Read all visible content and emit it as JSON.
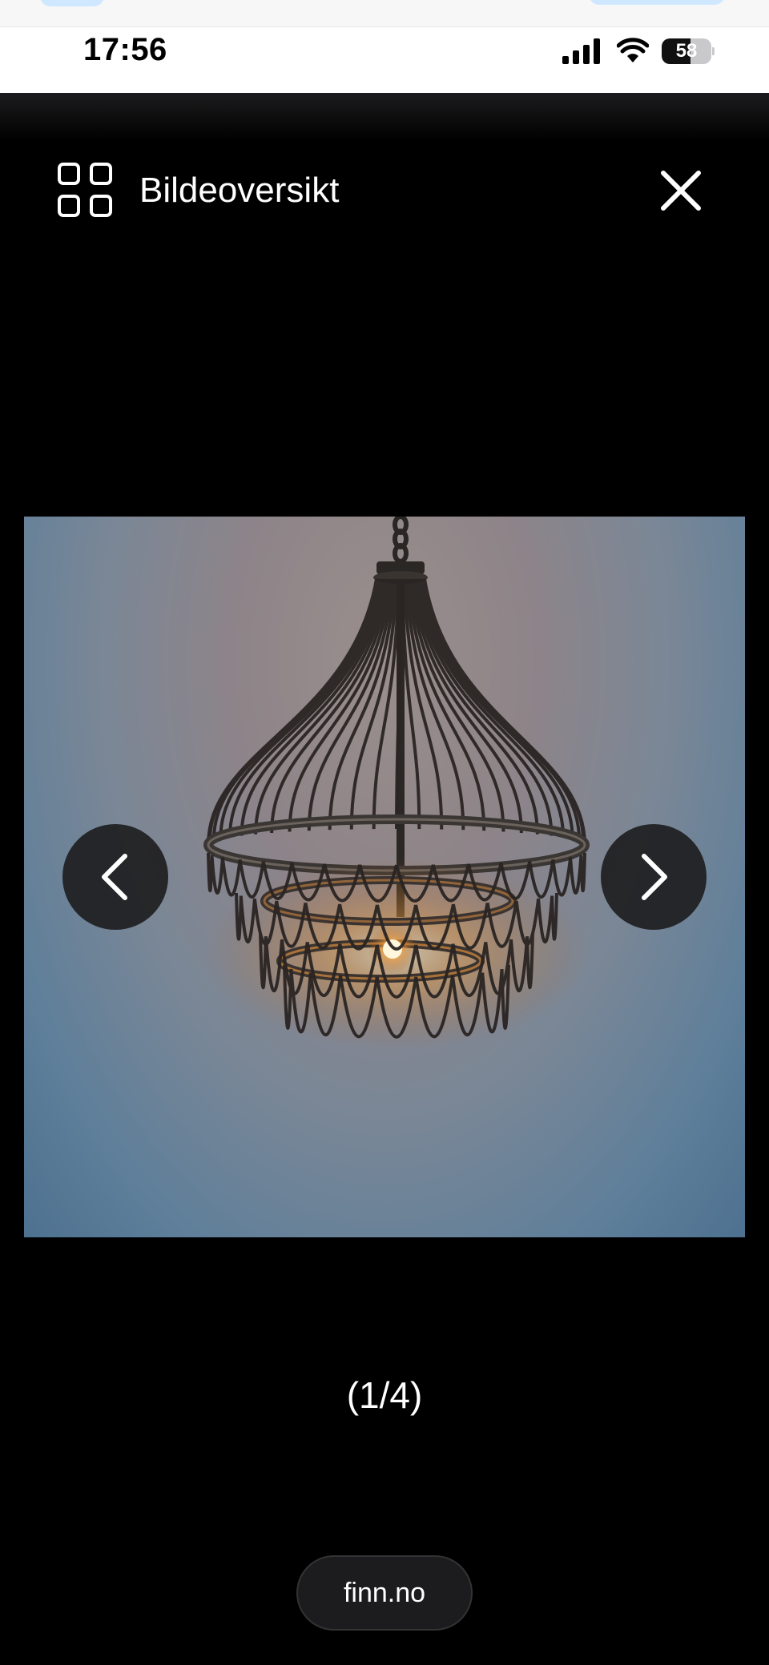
{
  "status": {
    "time": "17:56",
    "battery": "58",
    "battery_level": 0.58,
    "icons": [
      "cellular-signal-icon",
      "wifi-icon",
      "battery-icon"
    ]
  },
  "header": {
    "overview_label": "Bildeoversikt",
    "overview_icon": "grid-icon",
    "close_icon": "close-icon"
  },
  "gallery": {
    "counter": "(1/4)",
    "prev_icon": "chevron-left-icon",
    "next_icon": "chevron-right-icon"
  },
  "browser": {
    "url": "finn.no"
  },
  "colors": {
    "background": "#000000",
    "nav_button": "#1e1e20",
    "url_pill": "#1c1c1e"
  }
}
